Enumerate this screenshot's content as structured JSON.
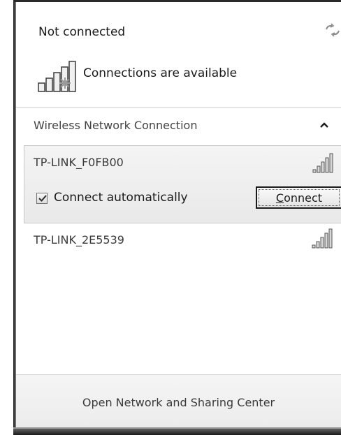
{
  "status": {
    "title": "Not connected",
    "available_text": "Connections are available"
  },
  "section": {
    "label": "Wireless Network Connection"
  },
  "networks": [
    {
      "name": "TP-LINK_F0FB00",
      "expanded": true,
      "signal_bars": 5,
      "auto_connect_label": "Connect automatically",
      "auto_connect_checked": true,
      "connect_button": {
        "accel": "C",
        "rest": "onnect"
      }
    },
    {
      "name": "TP-LINK_2E5539",
      "expanded": false,
      "signal_bars": 5
    }
  ],
  "footer": {
    "link": "Open Network and Sharing Center"
  },
  "icons": {
    "refresh": "refresh-icon",
    "available": "wireless-available-icon",
    "collapse": "chevron-up-icon",
    "signal": "signal-strength-icon",
    "check": "checkmark-icon"
  }
}
